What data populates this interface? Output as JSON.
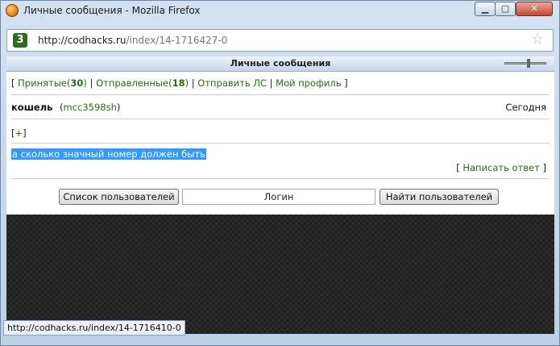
{
  "window": {
    "title": "Личные сообщения - Mozilla Firefox",
    "min_label": "▁",
    "max_label": "▢",
    "close_label": "✕"
  },
  "address": {
    "site_icon_text": "3",
    "url_base": "http://codhacks.ru",
    "url_rest": "/index/14-1716427-0",
    "star_glyph": "☆"
  },
  "panel": {
    "title": "Личные сообщения",
    "nav": {
      "open": "[ ",
      "inbox_label": "Принятые(",
      "inbox_count": "30",
      "inbox_close": ")",
      "sep1": " | ",
      "sent_label": "Отправленные(",
      "sent_count": "18",
      "sent_close": ")",
      "sep2": " | ",
      "send_label": "Отправить ЛС",
      "sep3": " | ",
      "profile_label": "Мой профиль",
      "close": " ]"
    },
    "message": {
      "sender": "кошель",
      "login_open": "(",
      "login": "mcc3598sh",
      "login_close": ")",
      "date": "Сегодня",
      "expand_open": "[",
      "expand": "+",
      "expand_close": "]",
      "text": "а сколько значный номер должен быть",
      "reply_open": "[ ",
      "reply": "Написать ответ",
      "reply_close": " ]"
    },
    "search": {
      "users_button": "Список пользователей",
      "login_value": "Логин",
      "find_button": "Найти пользователей"
    }
  },
  "status": {
    "url": "http://codhacks.ru/index/14-1716410-0"
  },
  "colors": {
    "link": "#2d6a17",
    "selection": "#3399ff",
    "page_bg": "#262626"
  },
  "icons": [
    "firefox-icon",
    "site-favicon",
    "bookmark-star-icon"
  ]
}
